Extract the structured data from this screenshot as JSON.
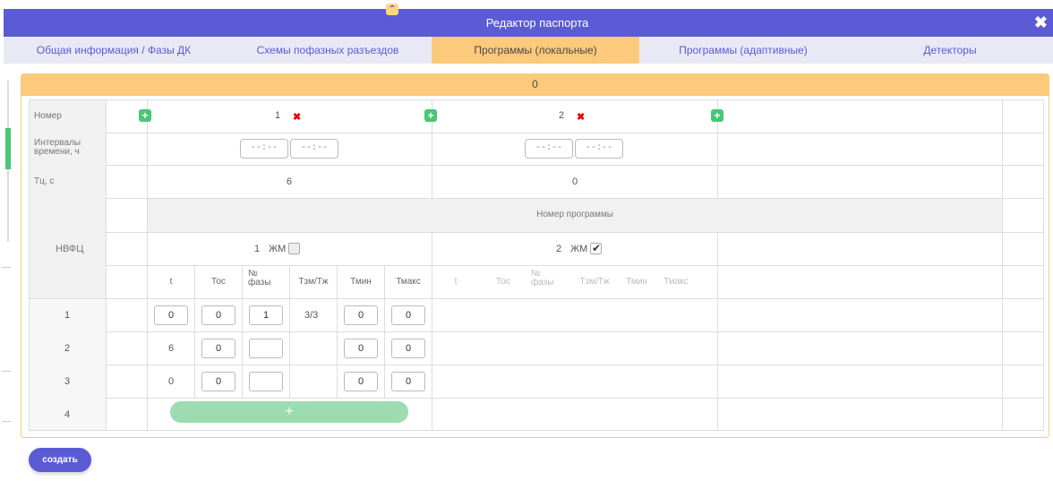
{
  "window": {
    "title": "Редактор паспорта",
    "close": "✖",
    "collapse": "⌃"
  },
  "tabs": [
    {
      "label": "Общая информация / Фазы ДК",
      "active": false
    },
    {
      "label": "Схемы пофазных разъездов",
      "active": false
    },
    {
      "label": "Программы (локальные)",
      "active": true
    },
    {
      "label": "Программы (адаптивные)",
      "active": false
    },
    {
      "label": "Детекторы",
      "active": false
    }
  ],
  "panel": {
    "header": "0"
  },
  "rows": {
    "nomer": "Номер",
    "intervals": "Интервалы времени, ч",
    "tc": "Тц, с",
    "nvfc": "НВФЦ"
  },
  "programs": [
    {
      "number": "1",
      "time_from": "--:--",
      "time_to": "--:--",
      "tc": "6",
      "jm_label": "ЖМ",
      "jm_checked": false
    },
    {
      "number": "2",
      "time_from": "--:--",
      "time_to": "--:--",
      "tc": "0",
      "jm_label": "ЖМ",
      "jm_checked": true
    }
  ],
  "program_number_header": "Номер программы",
  "columns": [
    "t",
    "Тос",
    "№ фазы",
    "Тзм/Тж",
    "Тмин",
    "Тмакс"
  ],
  "phase_rows": [
    {
      "idx": "1",
      "t": "0",
      "tos": "0",
      "phase": "1",
      "tzm": "3/3",
      "tmin": "0",
      "tmax": "0"
    },
    {
      "idx": "2",
      "t": "6",
      "tos": "0",
      "phase": "",
      "tzm": "",
      "tmin": "0",
      "tmax": "0"
    },
    {
      "idx": "3",
      "t": "0",
      "tos": "0",
      "phase": "",
      "tzm": "",
      "tmin": "0",
      "tmax": "0"
    },
    {
      "idx": "4"
    }
  ],
  "add_row_label": "+",
  "plus_label": "+",
  "delete_label": "✖",
  "create_button": "создать",
  "colors": {
    "accent": "#5b5bd6",
    "tab_active": "#fdc97a",
    "green": "#48c774"
  }
}
